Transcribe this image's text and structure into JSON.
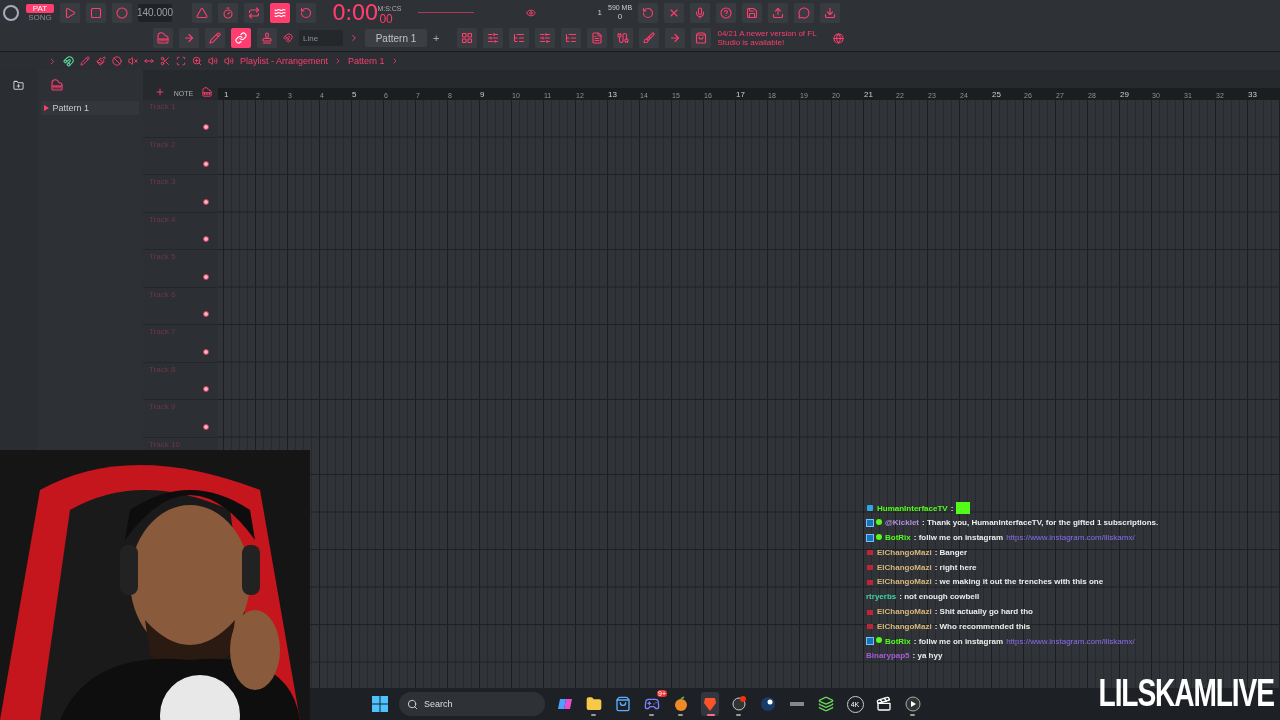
{
  "toolbar": {
    "modes": [
      {
        "label": "PAT",
        "selected": true
      },
      {
        "label": "SONG",
        "selected": false
      }
    ],
    "tempo": "140.000",
    "time": "0:00",
    "time_fraction": "00",
    "time_unit": "M:S:CS",
    "cpu": "1",
    "memory": "590 MB",
    "polyphony": "0",
    "snap": "Line",
    "pattern": "Pattern 1",
    "pattern_add": "+",
    "news": "04/21  A newer version of FL Studio is available!",
    "row1_buttons": [
      {
        "kind": "metronome",
        "on": false
      },
      {
        "kind": "wait",
        "on": false
      },
      {
        "kind": "countdown",
        "on": false
      },
      {
        "kind": "step",
        "on": true
      },
      {
        "kind": "loop",
        "on": false
      }
    ],
    "row2_buttons": [
      {
        "kind": "piano",
        "on": false
      },
      {
        "kind": "arrow",
        "on": false
      },
      {
        "kind": "pen",
        "on": false
      },
      {
        "kind": "link",
        "on": true
      },
      {
        "kind": "stamp",
        "on": false
      }
    ]
  },
  "playlist": {
    "breadcrumb": [
      "Playlist - Arrangement",
      "Pattern 1"
    ],
    "note_label": "NOTE",
    "picker": [
      {
        "label": "Pattern 1"
      }
    ],
    "tracks": [
      "Track 1",
      "Track 2",
      "Track 3",
      "Track 4",
      "Track 5",
      "Track 6",
      "Track 7",
      "Track 8",
      "Track 9",
      "Track 10"
    ],
    "bars": [
      "1",
      "2",
      "3",
      "4",
      "5",
      "6",
      "7",
      "8",
      "9",
      "10",
      "11",
      "12",
      "13",
      "14",
      "15",
      "16",
      "17",
      "18",
      "19",
      "20",
      "21",
      "22",
      "23",
      "24",
      "25",
      "26",
      "27",
      "28",
      "29",
      "30",
      "31",
      "32",
      "33"
    ]
  },
  "chat": [
    {
      "user": "HumanInterfaceTV",
      "color": "#53fc18",
      "kind": "subscriber",
      "text": ":",
      "emote": true
    },
    {
      "user": "@Kicklet",
      "color": "#b48fe0",
      "kind": "bot",
      "text": ": Thank you, HumanInterfaceTV, for the gifted 1 subscriptions."
    },
    {
      "user": "BotRix",
      "color": "#53fc18",
      "kind": "bot",
      "text": ": follw me on instagram",
      "link": "https://www.instagram.com/lilskamx/"
    },
    {
      "user": "ElChangoMazi",
      "color": "#d8b67c",
      "kind": "gift",
      "text": ": Banger"
    },
    {
      "user": "ElChangoMazi",
      "color": "#d8b67c",
      "kind": "gift",
      "text": ": right here"
    },
    {
      "user": "ElChangoMazi",
      "color": "#d8b67c",
      "kind": "gift",
      "text": ": we making it out the trenches with this one"
    },
    {
      "user": "rtryerbs",
      "color": "#3fd1a8",
      "kind": "plain",
      "text": ": not enough cowbell"
    },
    {
      "user": "ElChangoMazi",
      "color": "#d8b67c",
      "kind": "gift",
      "text": ": Shit actually go hard tho"
    },
    {
      "user": "ElChangoMazi",
      "color": "#d8b67c",
      "kind": "gift",
      "text": ": Who recommended this"
    },
    {
      "user": "BotRix",
      "color": "#53fc18",
      "kind": "bot",
      "text": ": follw me on instagram",
      "link": "https://www.instagram.com/lilskamx/"
    },
    {
      "user": "Binarypap5",
      "color": "#a45bd9",
      "kind": "plain",
      "text": ": ya hyy"
    }
  ],
  "overlay_title": "LILSKAMLIVE",
  "taskbar": {
    "search": "Search",
    "apps": [
      {
        "kind": "copilot",
        "active": false,
        "running": false
      },
      {
        "kind": "folder",
        "active": false,
        "running": true
      },
      {
        "kind": "store",
        "active": false,
        "running": false
      },
      {
        "kind": "discord",
        "active": false,
        "running": true,
        "badge": "9+"
      },
      {
        "kind": "fruit",
        "active": false,
        "running": true
      },
      {
        "kind": "lion",
        "active": true,
        "running": true
      },
      {
        "kind": "record",
        "active": false,
        "running": true
      },
      {
        "kind": "steam",
        "active": false,
        "running": false
      },
      {
        "kind": "dash",
        "active": false,
        "running": false
      },
      {
        "kind": "stack",
        "active": false,
        "running": false
      },
      {
        "kind": "circle",
        "active": false,
        "running": false,
        "label": "4K"
      },
      {
        "kind": "clip",
        "active": false,
        "running": false
      },
      {
        "kind": "play",
        "active": false,
        "running": true
      }
    ]
  }
}
